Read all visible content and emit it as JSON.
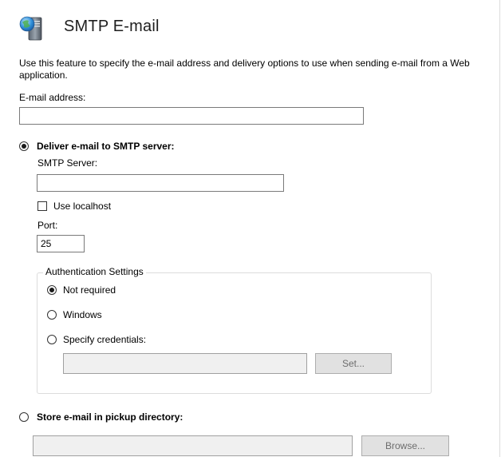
{
  "header": {
    "title": "SMTP E-mail",
    "icon": "server-globe-icon"
  },
  "description": "Use this feature to specify the e-mail address and delivery options to use when sending e-mail from a Web application.",
  "email": {
    "label": "E-mail address:",
    "value": ""
  },
  "deliver_smtp": {
    "label": "Deliver e-mail to SMTP server:",
    "selected": true,
    "server_label": "SMTP Server:",
    "server_value": "",
    "use_localhost_label": "Use localhost",
    "use_localhost_checked": false,
    "port_label": "Port:",
    "port_value": "25"
  },
  "authentication": {
    "legend": "Authentication Settings",
    "options": [
      {
        "label": "Not required",
        "selected": true
      },
      {
        "label": "Windows",
        "selected": false
      },
      {
        "label": "Specify credentials:",
        "selected": false
      }
    ],
    "credentials_value": "",
    "set_button": "Set..."
  },
  "pickup": {
    "label": "Store e-mail in pickup directory:",
    "selected": false,
    "directory_value": "",
    "browse_button": "Browse..."
  }
}
